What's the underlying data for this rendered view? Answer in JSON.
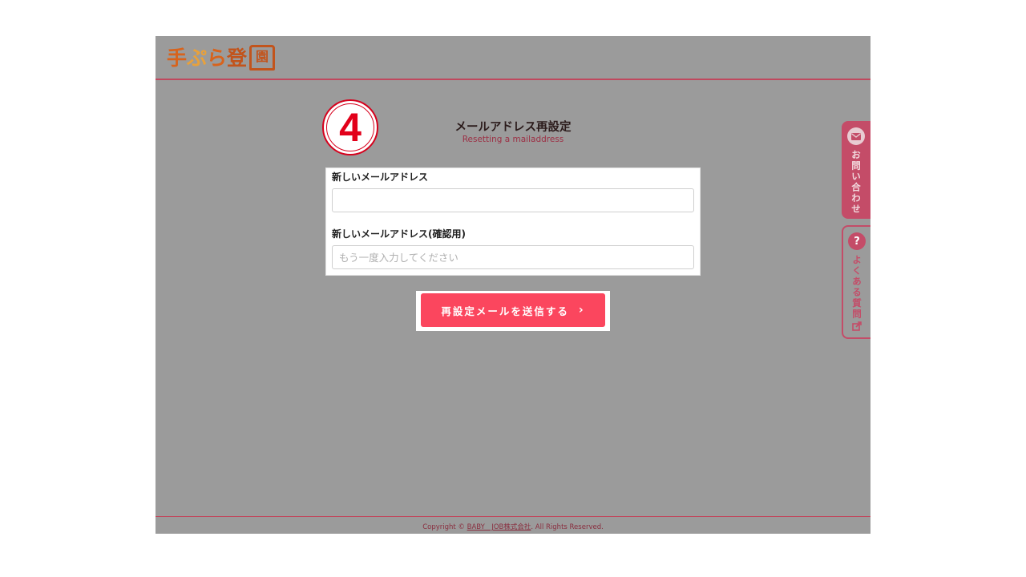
{
  "header": {
    "logo_chars": [
      "手",
      "ぷ",
      "ら",
      "登"
    ],
    "logo_box_char": "園"
  },
  "step": {
    "number": "4"
  },
  "page": {
    "title": "メールアドレス再設定",
    "subtitle": "Resetting a mailaddress"
  },
  "form": {
    "new_email_label": "新しいメールアドレス",
    "new_email_value": "",
    "confirm_email_label": "新しいメールアドレス(確認用)",
    "confirm_email_placeholder": "もう一度入力してください",
    "submit_label": "再設定メールを送信する",
    "submit_chevron": "›"
  },
  "side_tabs": {
    "contact_label": "お問い合わせ",
    "faq_label": "よくある質問",
    "contact_icon": "mail-icon",
    "faq_icon": "question-icon",
    "faq_ext_icon": "external-link-icon"
  },
  "footer": {
    "prefix": "Copyright © ",
    "company_link": "BABY　JOB株式会社",
    "suffix": ". All Rights Reserved."
  },
  "colors": {
    "overlay_gray": "#9b9b9b",
    "accent": "#c0485e",
    "button": "#fb465e",
    "step_red": "#e2001a"
  }
}
